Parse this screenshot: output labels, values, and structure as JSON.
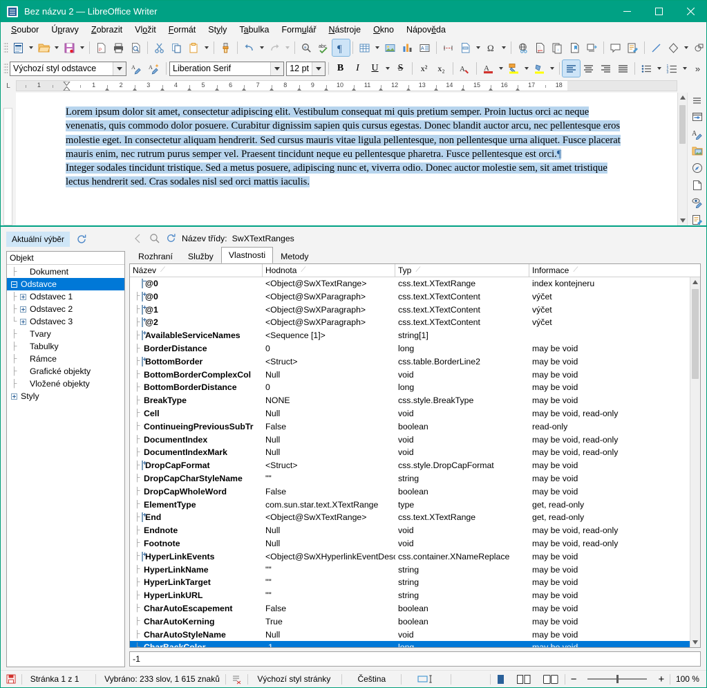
{
  "window": {
    "title": "Bez názvu 2 — LibreOffice Writer",
    "app_icon": "writer-document-icon",
    "minimize": "minimize-button",
    "maximize": "maximize-button",
    "close": "close-button"
  },
  "menubar": {
    "items": [
      {
        "label": "Soubor",
        "accel": "S"
      },
      {
        "label": "Úpravy",
        "accel": "p"
      },
      {
        "label": "Zobrazit",
        "accel": "Z"
      },
      {
        "label": "Vložit",
        "accel": "o"
      },
      {
        "label": "Formát",
        "accel": "F"
      },
      {
        "label": "Styly",
        "accel": "y"
      },
      {
        "label": "Tabulka",
        "accel": "a"
      },
      {
        "label": "Formulář",
        "accel": "u"
      },
      {
        "label": "Nástroje",
        "accel": "N"
      },
      {
        "label": "Okno",
        "accel": "O"
      },
      {
        "label": "Nápověda",
        "accel": "ě"
      }
    ]
  },
  "standard_toolbar": {
    "buttons": [
      "new-document-icon",
      "open-file-icon",
      "save-icon",
      "export-pdf-icon",
      "print-icon",
      "print-preview-icon",
      "cut-icon",
      "copy-icon",
      "paste-icon",
      "clone-formatting-icon",
      "undo-icon",
      "redo-icon",
      "find-replace-icon",
      "spelling-icon",
      "formatting-marks-icon",
      "insert-table-icon",
      "insert-image-icon",
      "insert-chart-icon",
      "insert-text-box-icon",
      "insert-page-break-icon",
      "insert-field-icon",
      "insert-special-character-icon",
      "insert-hyperlink-icon",
      "insert-footnote-icon",
      "insert-endnote-icon",
      "insert-bookmark-icon",
      "insert-cross-reference-icon",
      "insert-comment-icon",
      "track-changes-icon",
      "insert-line-icon",
      "basic-shapes-icon",
      "show-draw-functions-icon"
    ]
  },
  "formatting_toolbar": {
    "paragraph_style": "Výchozí styl odstavce",
    "font_name": "Liberation Serif",
    "font_size": "12 pt",
    "bold": "B",
    "italic": "I",
    "underline": "U",
    "strikethrough": "S",
    "superscript": "x²",
    "subscript": "x₂",
    "buttons": [
      "update-style-icon",
      "new-style-icon",
      "clear-formatting-icon",
      "font-color-icon",
      "highlight-color-icon",
      "character-highlighting-icon",
      "align-left-icon",
      "align-center-icon",
      "align-right-icon",
      "justified-icon",
      "unordered-list-icon",
      "ordered-list-icon",
      "overflow-chevron-icon"
    ],
    "active": "align-left-icon"
  },
  "ruler": {
    "left_numbers": [
      "1"
    ],
    "numbers": [
      "1",
      "2",
      "3",
      "4",
      "5",
      "6",
      "7",
      "8",
      "9",
      "10",
      "11",
      "12",
      "13",
      "14",
      "15",
      "16",
      "17",
      "18"
    ]
  },
  "document": {
    "paragraphs": [
      "Lorem ipsum dolor sit amet, consectetur adipiscing elit. Vestibulum consequat mi quis pretium semper. Proin luctus orci ac neque venenatis, quis commodo dolor posuere. Curabitur dignissim sapien quis cursus egestas. Donec blandit auctor arcu, nec pellentesque eros molestie eget. In consectetur aliquam hendrerit. Sed cursus mauris vitae ligula pellentesque, non pellentesque urna aliquet. Fusce placerat mauris enim, nec rutrum purus semper vel. Praesent tincidunt neque eu pellentesque pharetra. Fusce pellentesque est orci.",
      "Integer sodales tincidunt tristique. Sed a metus posuere, adipiscing nunc et, viverra odio. Donec auctor molestie sem, sit amet tristique lectus hendrerit sed. Cras sodales nisl sed orci mattis iaculis."
    ],
    "pilcrow": "¶",
    "selected": true
  },
  "sidebar_strip": {
    "items": [
      "sidebar-settings-icon",
      "properties-icon",
      "styles-icon",
      "gallery-icon",
      "navigator-icon",
      "page-icon",
      "style-inspector-icon",
      "manage-changes-icon",
      "accessibility-check-icon"
    ]
  },
  "devtools": {
    "current_selection_button": "Aktuální výběr",
    "refresh_icon": "refresh-icon",
    "tree_header": "Objekt",
    "tree": [
      {
        "label": "Dokument",
        "depth": 1,
        "expander": "none",
        "selected": false
      },
      {
        "label": "Odstavce",
        "depth": 0,
        "expander": "minus",
        "selected": true
      },
      {
        "label": "Odstavec 1",
        "depth": 1,
        "expander": "plus",
        "selected": false
      },
      {
        "label": "Odstavec 2",
        "depth": 1,
        "expander": "plus",
        "selected": false
      },
      {
        "label": "Odstavec 3",
        "depth": 1,
        "expander": "plus",
        "selected": false
      },
      {
        "label": "Tvary",
        "depth": 1,
        "expander": "none",
        "selected": false
      },
      {
        "label": "Tabulky",
        "depth": 1,
        "expander": "none",
        "selected": false
      },
      {
        "label": "Rámce",
        "depth": 1,
        "expander": "none",
        "selected": false
      },
      {
        "label": "Grafické objekty",
        "depth": 1,
        "expander": "none",
        "selected": false
      },
      {
        "label": "Vložené objekty",
        "depth": 1,
        "expander": "none",
        "selected": false
      },
      {
        "label": "Styly",
        "depth": 0,
        "expander": "plus",
        "selected": false
      }
    ],
    "breadcrumb": {
      "back_icon": "back-arrow-icon",
      "inspect_icon": "magnifier-icon",
      "refresh_icon": "refresh-icon",
      "label": "Název třídy:",
      "class_name": "SwXTextRanges"
    },
    "tabs": [
      {
        "label": "Rozhraní",
        "active": false
      },
      {
        "label": "Služby",
        "active": false
      },
      {
        "label": "Vlastnosti",
        "active": true
      },
      {
        "label": "Metody",
        "active": false
      }
    ],
    "columns": [
      "Název",
      "Hodnota",
      "Typ",
      "Informace"
    ],
    "rows": [
      {
        "name": "@0",
        "value": "<Object@SwXTextRange>",
        "type": "css.text.XTextRange",
        "info": "index kontejneru",
        "depth": 0,
        "expander": "minus",
        "selected": false
      },
      {
        "name": "@0",
        "value": "<Object@SwXParagraph>",
        "type": "css.text.XTextContent",
        "info": "výčet",
        "depth": 1,
        "expander": "plus",
        "selected": false
      },
      {
        "name": "@1",
        "value": "<Object@SwXParagraph>",
        "type": "css.text.XTextContent",
        "info": "výčet",
        "depth": 1,
        "expander": "plus",
        "selected": false
      },
      {
        "name": "@2",
        "value": "<Object@SwXParagraph>",
        "type": "css.text.XTextContent",
        "info": "výčet",
        "depth": 1,
        "expander": "plus",
        "selected": false
      },
      {
        "name": "AvailableServiceNames",
        "value": "<Sequence [1]>",
        "type": "string[1]",
        "info": "",
        "depth": 1,
        "expander": "plus",
        "selected": false
      },
      {
        "name": "BorderDistance",
        "value": "0",
        "type": "long",
        "info": "may be void",
        "depth": 1,
        "expander": "none",
        "selected": false
      },
      {
        "name": "BottomBorder",
        "value": "<Struct>",
        "type": "css.table.BorderLine2",
        "info": "may be void",
        "depth": 1,
        "expander": "plus",
        "selected": false
      },
      {
        "name": "BottomBorderComplexCol",
        "value": "Null",
        "type": "void",
        "info": "may be void",
        "depth": 1,
        "expander": "none",
        "selected": false
      },
      {
        "name": "BottomBorderDistance",
        "value": "0",
        "type": "long",
        "info": "may be void",
        "depth": 1,
        "expander": "none",
        "selected": false
      },
      {
        "name": "BreakType",
        "value": "NONE",
        "type": "css.style.BreakType",
        "info": "may be void",
        "depth": 1,
        "expander": "none",
        "selected": false
      },
      {
        "name": "Cell",
        "value": "Null",
        "type": "void",
        "info": "may be void, read-only",
        "depth": 1,
        "expander": "none",
        "selected": false
      },
      {
        "name": "ContinueingPreviousSubTr",
        "value": "False",
        "type": "boolean",
        "info": "read-only",
        "depth": 1,
        "expander": "none",
        "selected": false
      },
      {
        "name": "DocumentIndex",
        "value": "Null",
        "type": "void",
        "info": "may be void, read-only",
        "depth": 1,
        "expander": "none",
        "selected": false
      },
      {
        "name": "DocumentIndexMark",
        "value": "Null",
        "type": "void",
        "info": "may be void, read-only",
        "depth": 1,
        "expander": "none",
        "selected": false
      },
      {
        "name": "DropCapFormat",
        "value": "<Struct>",
        "type": "css.style.DropCapFormat",
        "info": "may be void",
        "depth": 1,
        "expander": "plus",
        "selected": false
      },
      {
        "name": "DropCapCharStyleName",
        "value": "\"\"",
        "type": "string",
        "info": "may be void",
        "depth": 1,
        "expander": "none",
        "selected": false
      },
      {
        "name": "DropCapWholeWord",
        "value": "False",
        "type": "boolean",
        "info": "may be void",
        "depth": 1,
        "expander": "none",
        "selected": false
      },
      {
        "name": "ElementType",
        "value": "com.sun.star.text.XTextRange",
        "type": "type",
        "info": "get, read-only",
        "depth": 1,
        "expander": "none",
        "selected": false
      },
      {
        "name": "End",
        "value": "<Object@SwXTextRange>",
        "type": "css.text.XTextRange",
        "info": "get, read-only",
        "depth": 1,
        "expander": "plus",
        "selected": false
      },
      {
        "name": "Endnote",
        "value": "Null",
        "type": "void",
        "info": "may be void, read-only",
        "depth": 1,
        "expander": "none",
        "selected": false
      },
      {
        "name": "Footnote",
        "value": "Null",
        "type": "void",
        "info": "may be void, read-only",
        "depth": 1,
        "expander": "none",
        "selected": false
      },
      {
        "name": "HyperLinkEvents",
        "value": "<Object@SwXHyperlinkEventDescrip",
        "type": "css.container.XNameReplace",
        "info": "may be void",
        "depth": 1,
        "expander": "plus",
        "selected": false
      },
      {
        "name": "HyperLinkName",
        "value": "\"\"",
        "type": "string",
        "info": "may be void",
        "depth": 1,
        "expander": "none",
        "selected": false
      },
      {
        "name": "HyperLinkTarget",
        "value": "\"\"",
        "type": "string",
        "info": "may be void",
        "depth": 1,
        "expander": "none",
        "selected": false
      },
      {
        "name": "HyperLinkURL",
        "value": "\"\"",
        "type": "string",
        "info": "may be void",
        "depth": 1,
        "expander": "none",
        "selected": false
      },
      {
        "name": "CharAutoEscapement",
        "value": "False",
        "type": "boolean",
        "info": "may be void",
        "depth": 1,
        "expander": "none",
        "selected": false
      },
      {
        "name": "CharAutoKerning",
        "value": "True",
        "type": "boolean",
        "info": "may be void",
        "depth": 1,
        "expander": "none",
        "selected": false
      },
      {
        "name": "CharAutoStyleName",
        "value": "Null",
        "type": "void",
        "info": "may be void",
        "depth": 1,
        "expander": "none",
        "selected": false
      },
      {
        "name": "CharBackColor",
        "value": "-1",
        "type": "long",
        "info": "may be void",
        "depth": 1,
        "expander": "none",
        "selected": true
      }
    ],
    "value_field": "-1"
  },
  "statusbar": {
    "save_icon": "save-status-icon",
    "page": "Stránka 1 z 1",
    "words": "Vybráno: 233 slov, 1 615 znaků",
    "outline_icon": "outline-folding-icon",
    "page_style": "Výchozí styl stránky",
    "language": "Čeština",
    "insert_mode_icon": "selection-mode-icon",
    "view_single_icon": "single-page-view-icon",
    "view_multi_icon": "multi-page-view-icon",
    "view_book_icon": "book-view-icon",
    "zoom_out": "−",
    "zoom_in": "+",
    "zoom_level": "100 %"
  },
  "colors": {
    "title_bar": "#00a184",
    "selection_blue": "#0078d7",
    "text_selection": "#b8d5ee",
    "accent_button": "#cfe6f7"
  }
}
